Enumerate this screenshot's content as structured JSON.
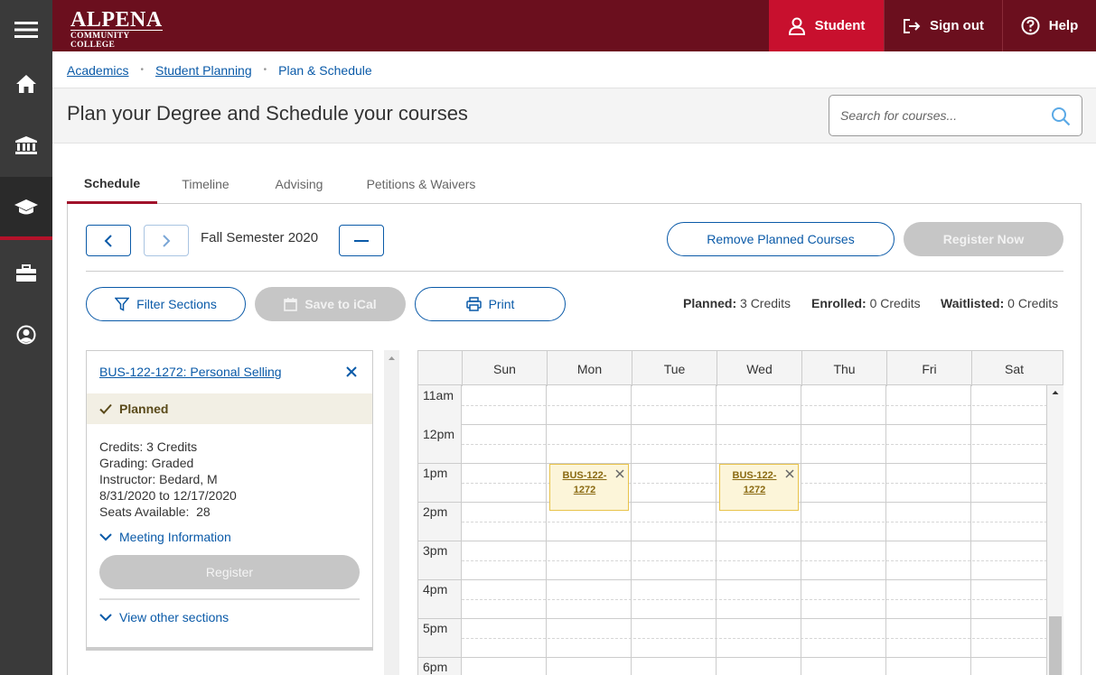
{
  "brand": {
    "line1": "ALPENA",
    "line2": "COMMUNITY COLLEGE"
  },
  "header": {
    "student_label": "Student",
    "signout_label": "Sign out",
    "help_label": "Help"
  },
  "breadcrumb": {
    "items": [
      "Academics",
      "Student Planning",
      "Plan & Schedule"
    ]
  },
  "page": {
    "title": "Plan your Degree and Schedule your courses"
  },
  "search": {
    "placeholder": "Search for courses..."
  },
  "tabs": [
    "Schedule",
    "Timeline",
    "Advising",
    "Petitions & Waivers"
  ],
  "term": {
    "label": "Fall Semester 2020"
  },
  "actions": {
    "remove_planned": "Remove Planned Courses",
    "register_now": "Register Now",
    "filter_sections": "Filter Sections",
    "save_ical": "Save to iCal",
    "print": "Print"
  },
  "credits": {
    "planned_label": "Planned:",
    "planned_value": "3 Credits",
    "enrolled_label": "Enrolled:",
    "enrolled_value": "0 Credits",
    "waitlisted_label": "Waitlisted:",
    "waitlisted_value": "0 Credits"
  },
  "course": {
    "title": "BUS-122-1272: Personal Selling",
    "status": "Planned",
    "credits": "Credits: 3 Credits",
    "grading": "Grading: Graded",
    "instructor": "Instructor: Bedard, M",
    "dates": "8/31/2020 to 12/17/2020",
    "seats": "Seats Available:  28",
    "meeting_info": "Meeting Information",
    "register": "Register",
    "view_other": "View other sections"
  },
  "calendar": {
    "days": [
      "Sun",
      "Mon",
      "Tue",
      "Wed",
      "Thu",
      "Fri",
      "Sat"
    ],
    "hours": [
      "11am",
      "12pm",
      "1pm",
      "2pm",
      "3pm",
      "4pm",
      "5pm",
      "6pm"
    ],
    "events": [
      {
        "day": "Mon",
        "line1": "BUS-122-",
        "line2": "1272"
      },
      {
        "day": "Wed",
        "line1": "BUS-122-",
        "line2": "1272"
      }
    ]
  },
  "colors": {
    "header_bg": "#6b0f1e",
    "accent": "#c8102e",
    "link": "#0a5aa8",
    "event_bg": "#fcf5d9"
  }
}
